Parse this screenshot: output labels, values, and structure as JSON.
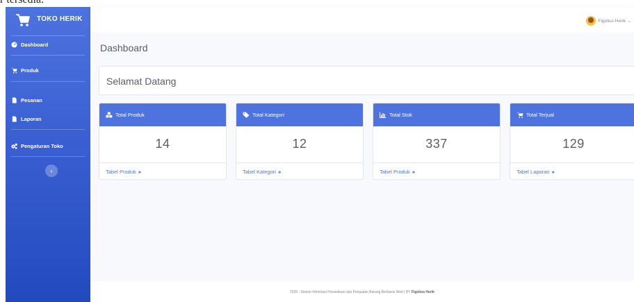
{
  "top_strip": {
    "text": "r tersedia."
  },
  "sidebar": {
    "brand": "TOKO HERIK",
    "items": [
      {
        "label": "Dashboard",
        "icon": "tachometer-icon"
      },
      {
        "label": "Produk",
        "icon": "cart-icon"
      },
      {
        "label": "Pesanan",
        "icon": "file-icon"
      },
      {
        "label": "Laporan",
        "icon": "file-icon"
      },
      {
        "label": "Pengaturan Toko",
        "icon": "cogs-icon"
      }
    ],
    "toggle_glyph": "‹"
  },
  "topbar": {
    "user_name": "Figolius Herik",
    "caret": "⌄"
  },
  "main": {
    "title": "Dashboard",
    "welcome": "Selamat Datang",
    "cards": [
      {
        "title": "Total Produk",
        "icon": "cubes-icon",
        "value": "14",
        "link": "Tabel Produk"
      },
      {
        "title": "Total Kategori",
        "icon": "tags-icon",
        "value": "12",
        "link": "Tabel Kategori"
      },
      {
        "title": "Total Stok",
        "icon": "chart-bar-icon",
        "value": "337",
        "link": "Tabel Produk"
      },
      {
        "title": "Total Terjual",
        "icon": "cart-icon",
        "value": "129",
        "link": "Tabel Laporan"
      }
    ],
    "link_chevron": "»"
  },
  "footer": {
    "text": "2025 - Sistem Informasi Persediaan dan Penjualan Barang Berbasis Web | BY ",
    "author": "Figolius Herik"
  },
  "colors": {
    "primary": "#4e73df",
    "primary_dark": "#224abe",
    "content_bg": "#f8f9fc",
    "text": "#5a5c69"
  }
}
